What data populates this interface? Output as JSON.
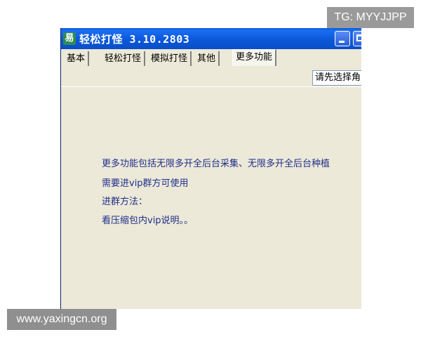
{
  "overlay": {
    "tg_badge": "TG: MYYJJPP",
    "site_watermark": "www.yaxingcn.org"
  },
  "window": {
    "app_icon": "易",
    "title": "轻松打怪 3.10.2803",
    "minimize_icon": "minimize-icon",
    "maximize_icon": "maximize-icon"
  },
  "tabs": [
    {
      "label": "基本",
      "active": false
    },
    {
      "label": "轻松打怪",
      "active": false
    },
    {
      "label": "模拟打怪",
      "active": false
    },
    {
      "label": "其他",
      "active": false
    },
    {
      "label": "更多功能",
      "active": true
    }
  ],
  "role_select": {
    "value": "请先选择角"
  },
  "content": {
    "lines": [
      "更多功能包括无限多开全后台采集、无限多开全后台种植",
      "需要进vip群方可使用",
      "进群方法：",
      "看压缩包内vip说明。。"
    ]
  },
  "colors": {
    "title_bar": "#0a5cd8",
    "window_bg": "#ece9d8",
    "text_blue": "#1f2e8a"
  }
}
